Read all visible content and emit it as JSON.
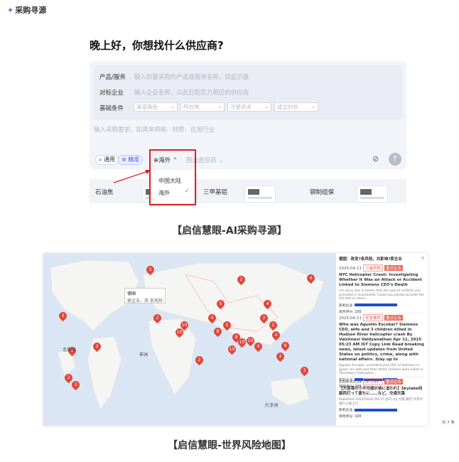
{
  "app": {
    "title": "采购寻源"
  },
  "greeting": "晚上好，你想找什么供应商?",
  "form": {
    "product_label": "产品/服务",
    "product_placeholder": "输入你要采购的产品或服务名称，如显示器",
    "company_label": "对标企业",
    "company_placeholder": "输入企业名称，以此匹配实力相近的供应商",
    "basic_label": "基础条件",
    "filters": [
      "渠道角色",
      "所在地",
      "注册资本",
      "成立时长"
    ],
    "requirement_placeholder": "输入采购要求，如具体规格、材质、应用行业"
  },
  "toolbar": {
    "general": "通用",
    "precise": "精准",
    "overseas": "海外",
    "template": "图选查招商"
  },
  "dropdown": {
    "options": [
      "中国大陆",
      "海外"
    ],
    "selected": "海外"
  },
  "cards": [
    "石油焦",
    "三甲基铝",
    "钢制组保"
  ],
  "caption1": "【启信慧眼-AI采购寻源】",
  "caption2": "【启信慧眼-世界风险地图】",
  "map": {
    "tooltip_title": "德国",
    "tooltip_sub": "家企业，风 条风险",
    "label_na": "北美洲",
    "label_africa": "非洲",
    "label_pacific": "大洋洲",
    "pins": [
      "2",
      "2",
      "4",
      "3",
      "2",
      "2",
      "2",
      "3",
      "10",
      "10",
      "2",
      "4",
      "8",
      "5",
      "8",
      "10",
      "10",
      "4",
      "2",
      "2",
      "4",
      "4",
      "5",
      "2",
      "10",
      "2",
      "3",
      "8"
    ]
  },
  "news": {
    "header": "德国：政变?条风险，共影响?家企业",
    "total": "共 7 条",
    "items": [
      {
        "date": "2025-04-11",
        "tag": "三级风险",
        "tag2": "重点企业",
        "headline": "NYC Helicopter Crash: Investigating Whether It Was an Attack or Accident Linked to Siemens CEO's Death",
        "body": "I'm sorry, but it seems that the source content you provided is incomplete. Could you please provide the full text or more...",
        "affected": "影响企业:",
        "score": "风险评分: 100"
      },
      {
        "date": "2025-04-11",
        "tag": "安全事件",
        "tag2": "重点企业",
        "headline": "Who was Agustin Escobar? Siemens CEO, wife and 3 children killed in Hudson River helicopter crash By Vaishnavi Vaidyanathan Apr 11, 2025 05:23 AM IST Copy Link Read breaking news, latest updates from United States on politics, crime, along with national affairs. Stay up to",
        "body": "Agustin Escobar, president and CEO of Siemens in Spain, his wife and their three children were killed in Thursday's helicopter...",
        "affected": "影响企业:",
        "score": "风险评分: 100"
      },
      {
        "date": "2025-03-24",
        "tag": "停工停产",
        "tag2": "重点企业",
        "headline": "【大连港の小平均値价格に追われ】Skylake向副西打って値ちに……など、交通天路",
        "body": "Published 2025/03/24 09:17 (JST) by 大阪 服行 今月今週から値上げ...",
        "affected": "影响企业:",
        "score": "风险评分: 100"
      }
    ]
  },
  "colors": {
    "accent": "#3b5bfd",
    "risk": "#e0483a",
    "highlight": "#e02020"
  }
}
